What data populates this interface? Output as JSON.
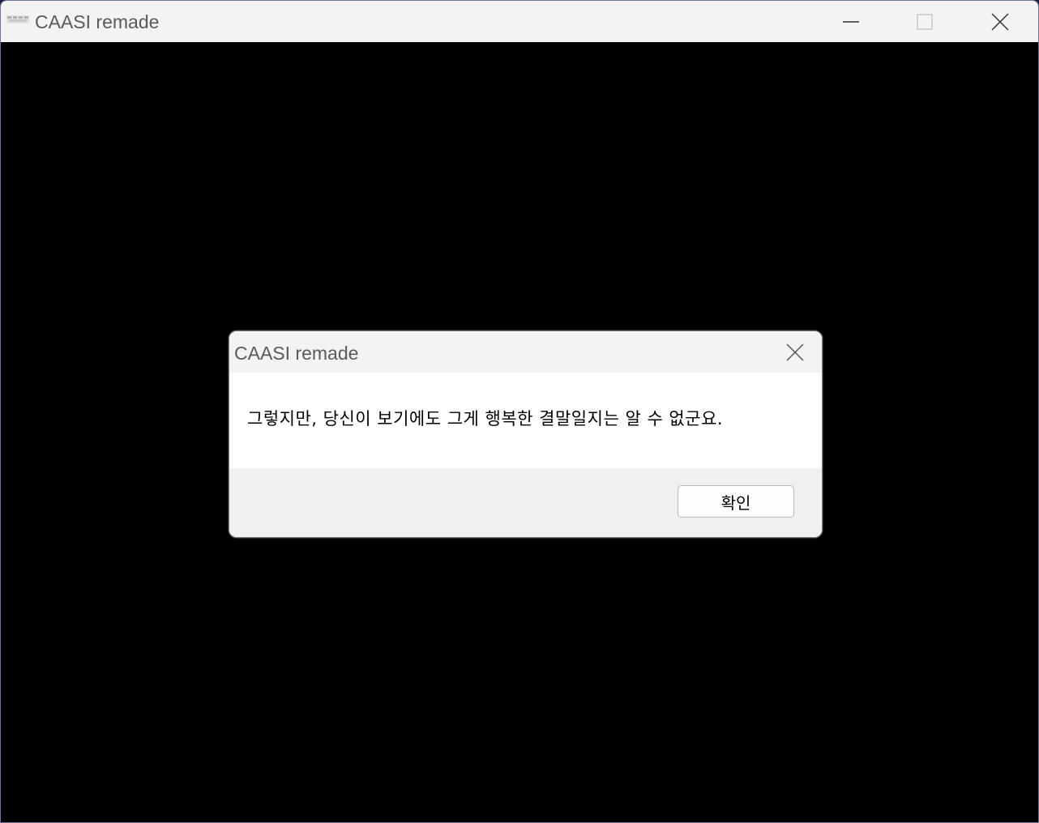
{
  "window": {
    "title": "CAASI remade",
    "icon": "app-logo-icon",
    "controls": {
      "minimize": "minimize-icon",
      "maximize": "maximize-icon",
      "close": "close-icon"
    }
  },
  "dialog": {
    "title": "CAASI remade",
    "message": "그렇지만, 당신이 보기에도 그게 행복한 결말일지는 알 수 없군요.",
    "ok_label": "확인",
    "close_icon": "close-icon"
  },
  "colors": {
    "titlebar": "#f3f3f3",
    "client_background": "#000000",
    "dialog_body": "#ffffff",
    "dialog_footer": "#f0f0f0"
  }
}
